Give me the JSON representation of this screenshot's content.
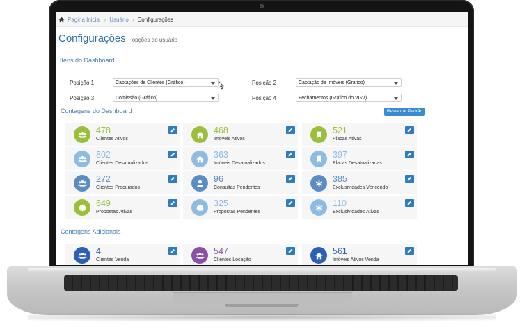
{
  "breadcrumb": {
    "home": "Pagina Inicial",
    "users": "Usuário",
    "current": "Configurações"
  },
  "page": {
    "title": "Configurações",
    "subtitle": "opções do usuário"
  },
  "dashboard_items": {
    "title": "Itens do Dashboard",
    "positions": [
      {
        "label": "Posição 1",
        "value": "Captações de Clientes (Gráfico)"
      },
      {
        "label": "Posição 2",
        "value": "Captação de Imóveis (Gráfico)"
      },
      {
        "label": "Posição 3",
        "value": "Comissão (Gráfico)"
      },
      {
        "label": "Posição 4",
        "value": "Fechamentos (Gráfico do VGV)"
      }
    ]
  },
  "dashboard_counts": {
    "title": "Contagens do Dashboard",
    "restore_label": "Restaurar Padrão",
    "cards": [
      {
        "value": "478",
        "label": "Clientes Ativos",
        "color": "#9bbf3a",
        "icon": "users-icon"
      },
      {
        "value": "468",
        "label": "Imóveis Ativos",
        "color": "#9bbf3a",
        "icon": "home-icon"
      },
      {
        "value": "521",
        "label": "Placas Ativas",
        "color": "#9bbf3a",
        "icon": "bookmark-icon"
      },
      {
        "value": "802",
        "label": "Clientes Desatualizados",
        "color": "#8fbbe0",
        "icon": "users-icon"
      },
      {
        "value": "363",
        "label": "Imóveis Desatualizados",
        "color": "#8fbbe0",
        "icon": "home-icon"
      },
      {
        "value": "397",
        "label": "Placas Desatualizadas",
        "color": "#8fbbe0",
        "icon": "bookmark-icon"
      },
      {
        "value": "272",
        "label": "Clientes Procurados",
        "color": "#5b8dc4",
        "icon": "users-icon"
      },
      {
        "value": "96",
        "label": "Consultas Pendentes",
        "color": "#5b8dc4",
        "icon": "user-icon"
      },
      {
        "value": "385",
        "label": "Exclusividades Vencendo",
        "color": "#5b8dc4",
        "icon": "asterisk-icon"
      },
      {
        "value": "649",
        "label": "Propostas Ativas",
        "color": "#9bbf3a",
        "icon": "badge-icon"
      },
      {
        "value": "325",
        "label": "Propostas Pendentes",
        "color": "#8fbbe0",
        "icon": "badge-icon"
      },
      {
        "value": "110",
        "label": "Exclusividades Ativas",
        "color": "#8fbbe0",
        "icon": "asterisk-icon"
      }
    ]
  },
  "additional_counts": {
    "title": "Contagens Adicionais",
    "cards": [
      {
        "value": "4",
        "label": "Clientes Venda",
        "color": "#2e5fb8",
        "icon": "users-icon"
      },
      {
        "value": "547",
        "label": "Clientes Locação",
        "color": "#8a4fa8",
        "icon": "users-icon"
      },
      {
        "value": "561",
        "label": "Imóveis Ativos Venda",
        "color": "#2e5fb8",
        "icon": "home-icon"
      }
    ]
  },
  "colors": {
    "accent": "#2e6da4",
    "button": "#3b8bd1",
    "edit": "#2e7dc0"
  }
}
